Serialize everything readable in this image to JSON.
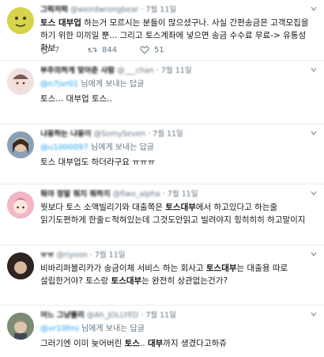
{
  "tweets": [
    {
      "name": "그럭저럭",
      "handle": "@weirdwrongbear",
      "time": "· 7월 11일",
      "body": [
        {
          "t": "토스 대부업",
          "b": true
        },
        {
          "t": " 하는거 모르시는 분들이 많으셨구나. 사실 간편송금은 고객모집을 하기 위한 미끼일 뿐... 그리고 토스계좌에 넣으면 송금 수수료 무료-> 유통성 확보",
          "b": false
        }
      ],
      "replies": "7",
      "retweets": "844",
      "likes": "51"
    },
    {
      "name": "부주의하게 맞아준 사람",
      "handle": "@___chan",
      "time": "· 7월 11일",
      "reply_mention": "@n7jvr01",
      "reply_suffix": " 님에게 보내는 답글",
      "body": [
        {
          "t": "토스... 대부업 토스..",
          "b": false
        }
      ]
    },
    {
      "name": "냐옹하는 냐옹이",
      "handle": "@SomySeven",
      "time": "· 7월 11일",
      "reply_mention": "@u1000097",
      "reply_suffix": " 님에게 보내는 답글",
      "body": [
        {
          "t": "토스 대부업도 하더라구요 ㅠㅠㅠ",
          "b": false
        }
      ]
    },
    {
      "name": "뭐야 정말 뭐지 뭐하지",
      "handle": "@fiwo_alpha",
      "time": "· 7월 11일",
      "body": [
        {
          "t": "뭣보다 토스 소액빌리기와 대출쪽은 ",
          "b": false
        },
        {
          "t": "토스대부",
          "b": true
        },
        {
          "t": "에서 하고있다고 하는줄 읽기도편하게 한줄ㄷ적혀있는데 그것도안읽고 빌려야지 힝히히히 하고말이지",
          "b": false
        }
      ]
    },
    {
      "name": "ㅠㅠ",
      "handle": "@riyoon",
      "time": "· 7월 11일",
      "body": [
        {
          "t": "비바리퍼블리카가 송금이체 서비스 하는 회사고 ",
          "b": false
        },
        {
          "t": "토스대부",
          "b": true
        },
        {
          "t": "는 대출용 따로 설립한거야? 토스랑 ",
          "b": false
        },
        {
          "t": "토스대부",
          "b": true
        },
        {
          "t": "는 완전히 상관없는건가?",
          "b": false
        }
      ]
    },
    {
      "name": "어느 그냥물리",
      "handle": "@Ah_JOLLYED",
      "time": "· 7월 11일",
      "reply_mention": "@vr10fmi",
      "reply_suffix": " 님에게 보내는 답글",
      "body": [
        {
          "t": "그러기엔 이미 늦어버린 ",
          "b": false
        },
        {
          "t": "토스",
          "b": true
        },
        {
          "t": ".. ",
          "b": false
        },
        {
          "t": "대부",
          "b": true
        },
        {
          "t": "까지 생겼다고하쥬",
          "b": false
        }
      ]
    }
  ],
  "colors": {
    "text": "#14171a",
    "muted": "#657786",
    "link": "#1da1f2",
    "divider": "#e6ecf0"
  },
  "icons": [
    "reply-icon",
    "retweet-icon",
    "like-icon",
    "caret-down-icon",
    "avatar"
  ]
}
